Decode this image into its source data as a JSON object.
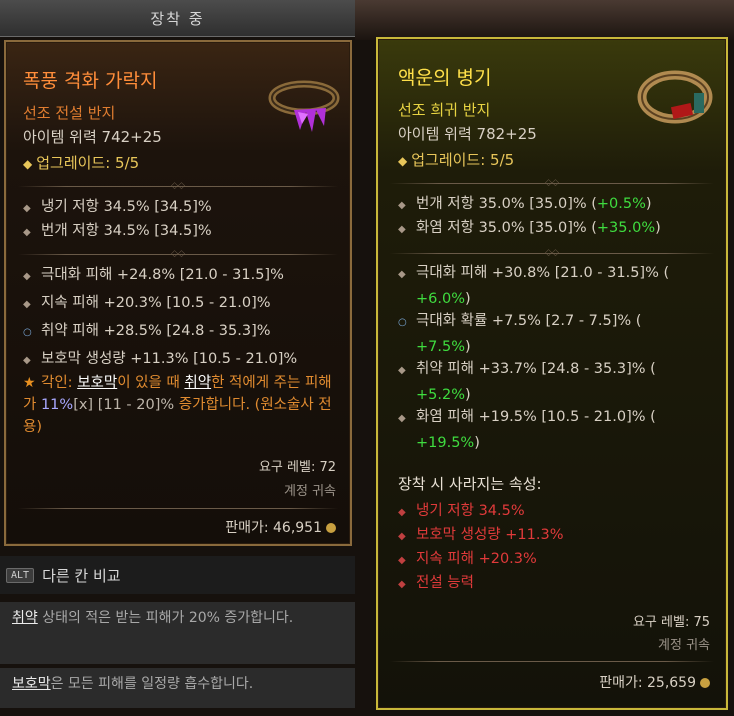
{
  "equipped_header": "장착 중",
  "left_item": {
    "name": "폭풍 격화 가락지",
    "rarity": "선조 전설 반지",
    "power": "아이템 위력 742+25",
    "upgrade": "업그레이드: 5/5",
    "implicits": [
      "냉기 저항 34.5% [34.5]%",
      "번개 저항 34.5% [34.5]%"
    ],
    "affixes": [
      "극대화 피해 +24.8% [21.0 - 31.5]%",
      "지속 피해 +20.3% [10.5 - 21.0]%",
      "취약 피해 +28.5% [24.8 - 35.3]%",
      "보호막 생성량 +11.3% [10.5 - 21.0]%"
    ],
    "aspect": {
      "p1": "각인: ",
      "kw1": "보호막",
      "p2": "이 있을 때 ",
      "kw2": "취약",
      "p3": "한 적에게 주는 피해가 ",
      "val": "11%",
      "p4": "[x] ",
      "range": "[11 - 20]%",
      "p5": " 증가합니다. (원소술사 전용)"
    },
    "required_level": "요구 레벨: 72",
    "bound": "계정 귀속",
    "sell": "판매가: 46,951"
  },
  "right_item": {
    "name": "액운의 병기",
    "rarity": "선조 희귀 반지",
    "power": "아이템 위력 782+25",
    "upgrade": "업그레이드: 5/5",
    "implicits": [
      {
        "text": "번개 저항 35.0% [35.0]% (",
        "delta": "+0.5%",
        "tail": ")"
      },
      {
        "text": "화염 저항 35.0% [35.0]% (",
        "delta": "+35.0%",
        "tail": ")"
      }
    ],
    "affixes": [
      {
        "text": "극대화 피해 +30.8% [21.0 - 31.5]% (",
        "delta": "+6.0%",
        "tail": ")"
      },
      {
        "text": "극대화 확률 +7.5% [2.7 - 7.5]% (",
        "delta": "+7.5%",
        "tail": ")"
      },
      {
        "text": "취약 피해 +33.7% [24.8 - 35.3]% (",
        "delta": "+5.2%",
        "tail": ")"
      },
      {
        "text": "화염 피해 +19.5% [10.5 - 21.0]% (",
        "delta": "+19.5%",
        "tail": ")"
      }
    ],
    "lost_title": "장착 시 사라지는 속성:",
    "lost": [
      "냉기 저항 34.5%",
      "보호막 생성량 +11.3%",
      "지속 피해 +20.3%",
      "전설 능력"
    ],
    "required_level": "요구 레벨: 75",
    "bound": "계정 귀속",
    "sell": "판매가: 25,659"
  },
  "compare": {
    "key": "ALT",
    "label": "다른 칸 비교"
  },
  "tips": [
    {
      "kw": "취약",
      "text": " 상태의 적은 받는 피해가 20% 증가합니다."
    },
    {
      "kw": "보호막",
      "text": "은 모든 피해를 일정량 흡수합니다."
    }
  ],
  "colors": {
    "legendary": "#ff8d3a",
    "rare": "#ffe04a",
    "positive": "#3fdc3f",
    "negative": "#e03a3a"
  }
}
